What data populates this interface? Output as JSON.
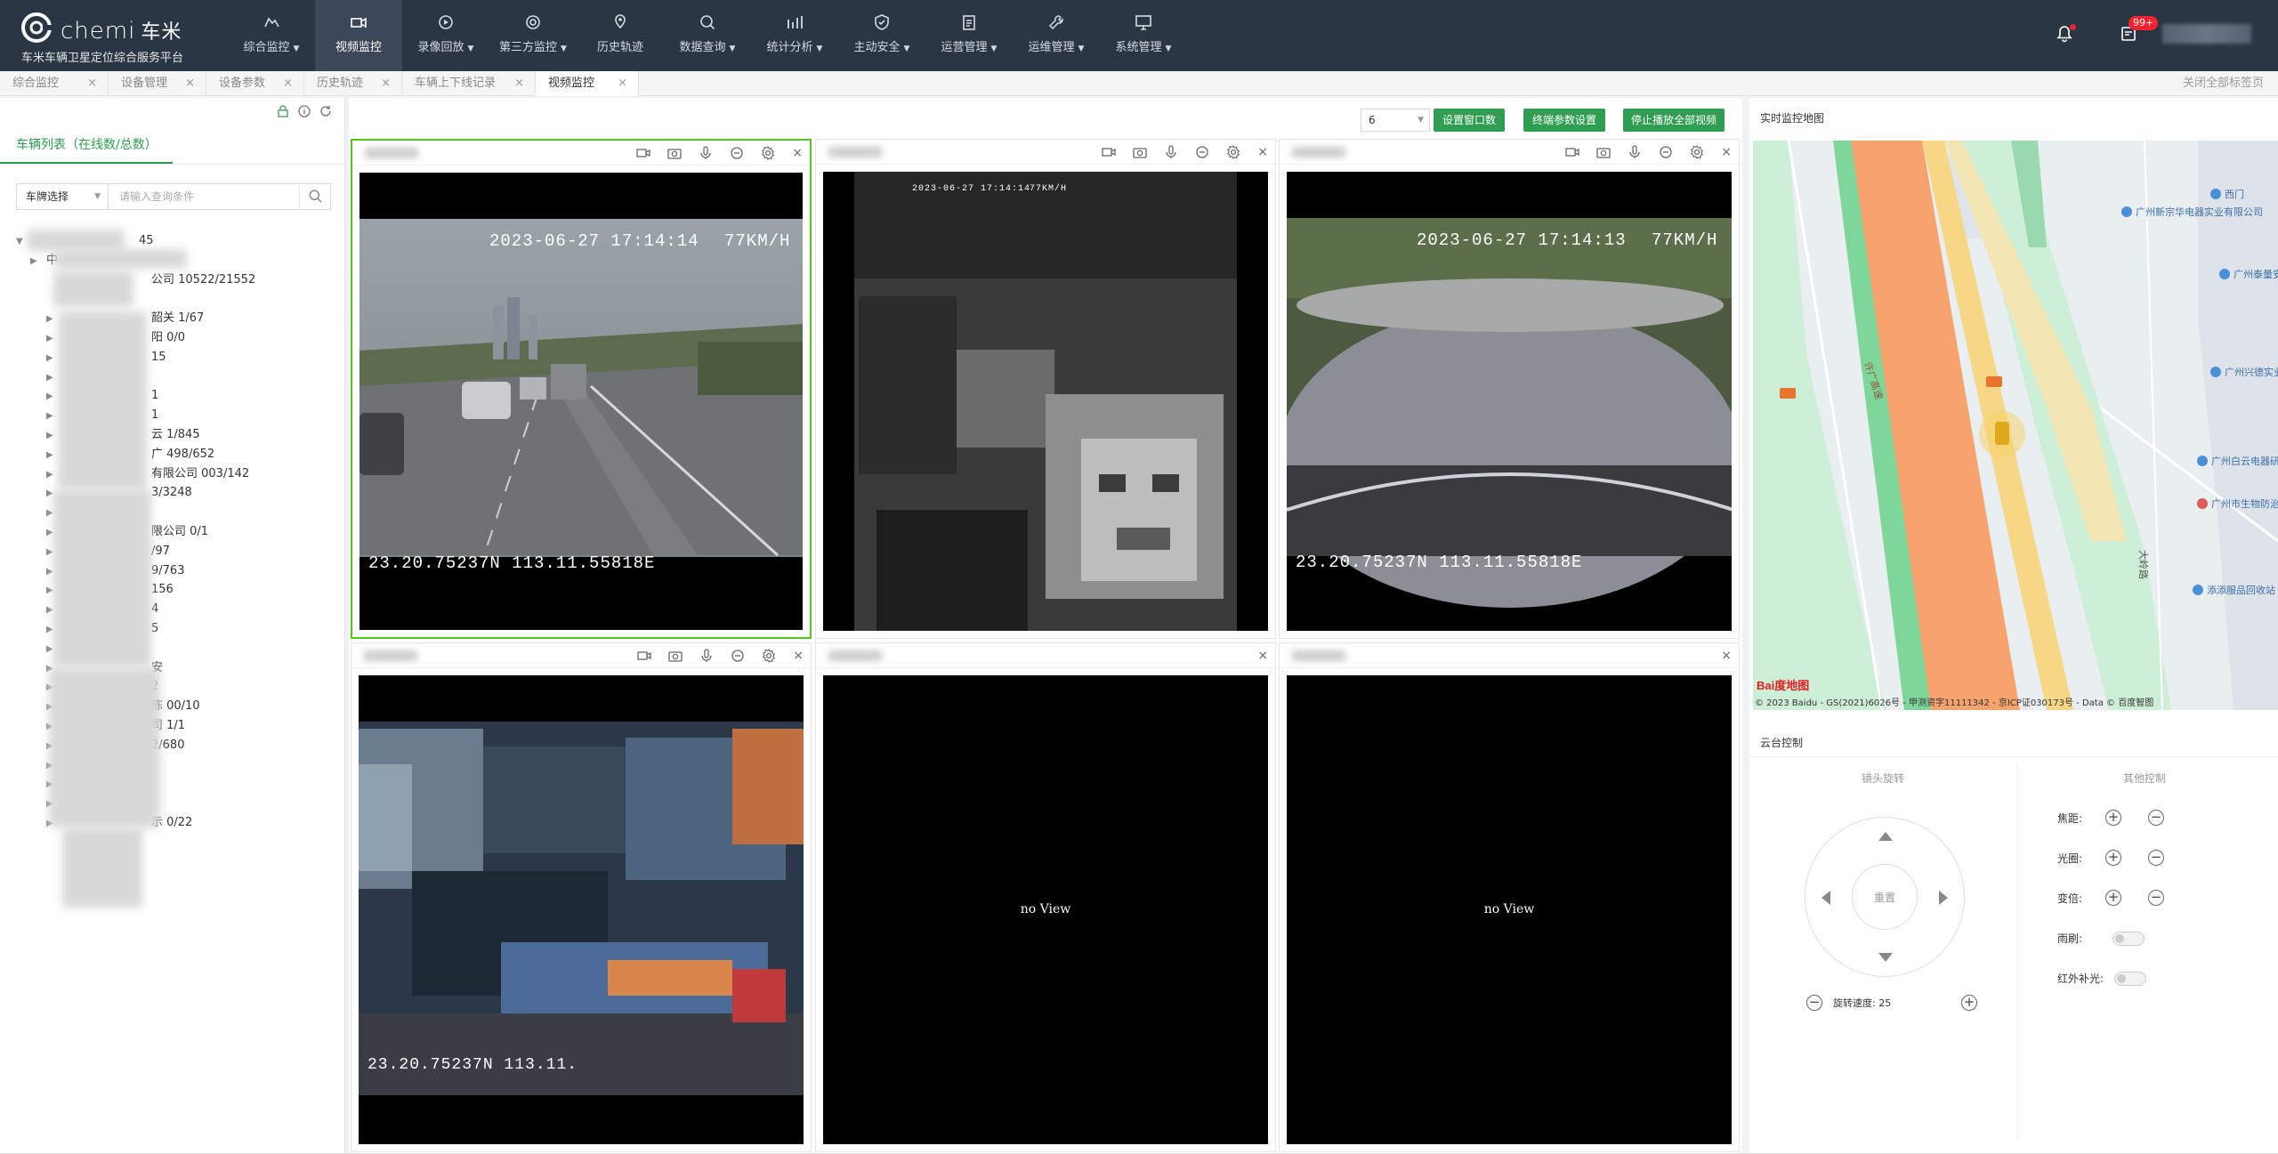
{
  "brand": {
    "name": "chemi",
    "name_cn": "车米",
    "subtitle": "车米车辆卫星定位综合服务平台"
  },
  "nav": [
    {
      "label": "综合监控",
      "icon": "monitor-icon",
      "dropdown": true,
      "active": false
    },
    {
      "label": "视频监控",
      "icon": "video-icon",
      "dropdown": false,
      "active": true
    },
    {
      "label": "录像回放",
      "icon": "replay-icon",
      "dropdown": true,
      "active": false
    },
    {
      "label": "第三方监控",
      "icon": "radar-icon",
      "dropdown": true,
      "active": false
    },
    {
      "label": "历史轨迹",
      "icon": "location-icon",
      "dropdown": false,
      "active": false
    },
    {
      "label": "数据查询",
      "icon": "search-data-icon",
      "dropdown": true,
      "active": false
    },
    {
      "label": "统计分析",
      "icon": "chart-icon",
      "dropdown": true,
      "active": false
    },
    {
      "label": "主动安全",
      "icon": "shield-icon",
      "dropdown": true,
      "active": false
    },
    {
      "label": "运营管理",
      "icon": "clipboard-icon",
      "dropdown": true,
      "active": false
    },
    {
      "label": "运维管理",
      "icon": "wrench-icon",
      "dropdown": true,
      "active": false
    },
    {
      "label": "系统管理",
      "icon": "system-icon",
      "dropdown": true,
      "active": false
    }
  ],
  "header": {
    "msg_badge": "99+"
  },
  "tabs": [
    {
      "label": "综合监控",
      "close": "×",
      "active": false
    },
    {
      "label": "设备管理",
      "close": "×",
      "active": false
    },
    {
      "label": "设备参数",
      "close": "×",
      "active": false
    },
    {
      "label": "历史轨迹",
      "close": "×",
      "active": false
    },
    {
      "label": "车辆上下线记录",
      "close": "×",
      "active": false
    },
    {
      "label": "视频监控",
      "close": "×",
      "active": true
    }
  ],
  "tabbar": {
    "close_all": "关闭全部标签页"
  },
  "left": {
    "title": "车辆列表（在线数/总数）",
    "select_label": "车牌选择",
    "search_placeholder": "请输入查询条件",
    "tree": [
      {
        "text": "45",
        "arrow": "▼"
      },
      {
        "text": "中",
        "arrow": "▶"
      },
      {
        "text": "公司 10522/21552",
        "arrow": ""
      },
      {
        "text": "",
        "arrow": ""
      },
      {
        "text": "韶关 1/67",
        "arrow": "▶"
      },
      {
        "text": "阳 0/0",
        "arrow": "▶"
      },
      {
        "text": "15",
        "arrow": "▶"
      },
      {
        "text": "",
        "arrow": "▶"
      },
      {
        "text": "1",
        "arrow": "▶"
      },
      {
        "text": "1",
        "arrow": "▶"
      },
      {
        "text": "云 1/845",
        "arrow": "▶"
      },
      {
        "text": "广 498/652",
        "arrow": "▶"
      },
      {
        "text": "有限公司 003/142",
        "arrow": "▶"
      },
      {
        "text": "3/3248",
        "arrow": "▶"
      },
      {
        "text": "",
        "arrow": "▶"
      },
      {
        "text": "限公司 0/1",
        "arrow": "▶"
      },
      {
        "text": "/97",
        "arrow": "▶"
      },
      {
        "text": "9/763",
        "arrow": "▶"
      },
      {
        "text": "156",
        "arrow": "▶"
      },
      {
        "text": "4",
        "arrow": "▶"
      },
      {
        "text": "5",
        "arrow": "▶"
      },
      {
        "text": "",
        "arrow": "▶"
      },
      {
        "text": "安",
        "arrow": "▶"
      },
      {
        "text": "2",
        "arrow": "▶"
      },
      {
        "text": "陈 00/10",
        "arrow": "▶"
      },
      {
        "text": "司 1/1",
        "arrow": "▶"
      },
      {
        "text": "2/680",
        "arrow": "▶"
      },
      {
        "text": "",
        "arrow": "▶"
      },
      {
        "text": "",
        "arrow": "▶"
      },
      {
        "text": "",
        "arrow": "▶"
      },
      {
        "text": "示 0/22",
        "arrow": "▶"
      }
    ]
  },
  "controls": {
    "window_count": "6",
    "set_window_button": "设置窗口数",
    "terminal_params_button": "终端参数设置",
    "stop_all_button": "停止播放全部视频"
  },
  "videos": [
    {
      "state": "road",
      "timestamp": "2023-06-27 17:14:14",
      "speed": "77KM/H",
      "gps": "23.20.75237N 113.11.55818E"
    },
    {
      "state": "cabin",
      "timestamp": "2023-06-27 17:14:14",
      "speed": "77KM/H",
      "gps": ""
    },
    {
      "state": "side",
      "timestamp": "2023-06-27 17:14:13",
      "speed": "77KM/H",
      "gps": "23.20.75237N 113.11.55818E"
    },
    {
      "state": "interior",
      "timestamp": "",
      "speed": "",
      "gps": "23.20.75237N 113.11."
    },
    {
      "state": "empty",
      "no_view": "no View"
    },
    {
      "state": "empty",
      "no_view": "no View"
    }
  ],
  "map": {
    "title": "实时监控地图",
    "road_label": "许广高速",
    "logo": "Bai度地图",
    "copyright": "© 2023 Baidu - GS(2021)6026号 - 甲测资字11111342 - 京ICP证030173号 - Data © 百度智图",
    "pois": [
      "西门",
      "广州新宗华电器实业有限公司",
      "广州泰量安装有限",
      "广州兴德实业有限",
      "广州白云电器研究所",
      "广州市生物防治站",
      "大岭路",
      "添添服品回收站"
    ]
  },
  "ptz": {
    "title": "云台控制",
    "lens_title": "镜头旋转",
    "other_title": "其他控制",
    "reset": "重置",
    "speed_label": "旋转速度: 25",
    "focus": "焦距:",
    "aperture": "光圈:",
    "zoom": "变倍:",
    "wiper": "雨刷:",
    "ir": "红外补光:"
  }
}
